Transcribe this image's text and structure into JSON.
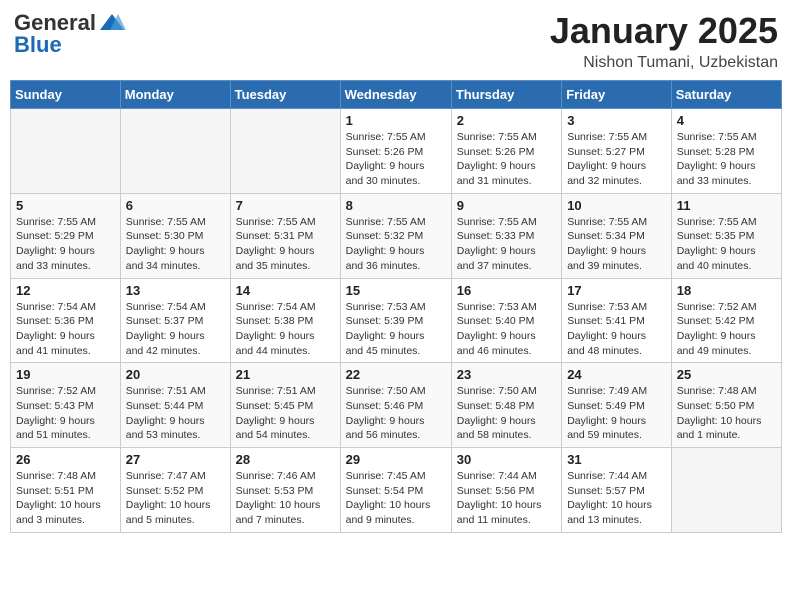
{
  "header": {
    "logo_general": "General",
    "logo_blue": "Blue",
    "month_title": "January 2025",
    "subtitle": "Nishon Tumani, Uzbekistan"
  },
  "weekdays": [
    "Sunday",
    "Monday",
    "Tuesday",
    "Wednesday",
    "Thursday",
    "Friday",
    "Saturday"
  ],
  "weeks": [
    [
      {
        "day": "",
        "info": ""
      },
      {
        "day": "",
        "info": ""
      },
      {
        "day": "",
        "info": ""
      },
      {
        "day": "1",
        "info": "Sunrise: 7:55 AM\nSunset: 5:26 PM\nDaylight: 9 hours\nand 30 minutes."
      },
      {
        "day": "2",
        "info": "Sunrise: 7:55 AM\nSunset: 5:26 PM\nDaylight: 9 hours\nand 31 minutes."
      },
      {
        "day": "3",
        "info": "Sunrise: 7:55 AM\nSunset: 5:27 PM\nDaylight: 9 hours\nand 32 minutes."
      },
      {
        "day": "4",
        "info": "Sunrise: 7:55 AM\nSunset: 5:28 PM\nDaylight: 9 hours\nand 33 minutes."
      }
    ],
    [
      {
        "day": "5",
        "info": "Sunrise: 7:55 AM\nSunset: 5:29 PM\nDaylight: 9 hours\nand 33 minutes."
      },
      {
        "day": "6",
        "info": "Sunrise: 7:55 AM\nSunset: 5:30 PM\nDaylight: 9 hours\nand 34 minutes."
      },
      {
        "day": "7",
        "info": "Sunrise: 7:55 AM\nSunset: 5:31 PM\nDaylight: 9 hours\nand 35 minutes."
      },
      {
        "day": "8",
        "info": "Sunrise: 7:55 AM\nSunset: 5:32 PM\nDaylight: 9 hours\nand 36 minutes."
      },
      {
        "day": "9",
        "info": "Sunrise: 7:55 AM\nSunset: 5:33 PM\nDaylight: 9 hours\nand 37 minutes."
      },
      {
        "day": "10",
        "info": "Sunrise: 7:55 AM\nSunset: 5:34 PM\nDaylight: 9 hours\nand 39 minutes."
      },
      {
        "day": "11",
        "info": "Sunrise: 7:55 AM\nSunset: 5:35 PM\nDaylight: 9 hours\nand 40 minutes."
      }
    ],
    [
      {
        "day": "12",
        "info": "Sunrise: 7:54 AM\nSunset: 5:36 PM\nDaylight: 9 hours\nand 41 minutes."
      },
      {
        "day": "13",
        "info": "Sunrise: 7:54 AM\nSunset: 5:37 PM\nDaylight: 9 hours\nand 42 minutes."
      },
      {
        "day": "14",
        "info": "Sunrise: 7:54 AM\nSunset: 5:38 PM\nDaylight: 9 hours\nand 44 minutes."
      },
      {
        "day": "15",
        "info": "Sunrise: 7:53 AM\nSunset: 5:39 PM\nDaylight: 9 hours\nand 45 minutes."
      },
      {
        "day": "16",
        "info": "Sunrise: 7:53 AM\nSunset: 5:40 PM\nDaylight: 9 hours\nand 46 minutes."
      },
      {
        "day": "17",
        "info": "Sunrise: 7:53 AM\nSunset: 5:41 PM\nDaylight: 9 hours\nand 48 minutes."
      },
      {
        "day": "18",
        "info": "Sunrise: 7:52 AM\nSunset: 5:42 PM\nDaylight: 9 hours\nand 49 minutes."
      }
    ],
    [
      {
        "day": "19",
        "info": "Sunrise: 7:52 AM\nSunset: 5:43 PM\nDaylight: 9 hours\nand 51 minutes."
      },
      {
        "day": "20",
        "info": "Sunrise: 7:51 AM\nSunset: 5:44 PM\nDaylight: 9 hours\nand 53 minutes."
      },
      {
        "day": "21",
        "info": "Sunrise: 7:51 AM\nSunset: 5:45 PM\nDaylight: 9 hours\nand 54 minutes."
      },
      {
        "day": "22",
        "info": "Sunrise: 7:50 AM\nSunset: 5:46 PM\nDaylight: 9 hours\nand 56 minutes."
      },
      {
        "day": "23",
        "info": "Sunrise: 7:50 AM\nSunset: 5:48 PM\nDaylight: 9 hours\nand 58 minutes."
      },
      {
        "day": "24",
        "info": "Sunrise: 7:49 AM\nSunset: 5:49 PM\nDaylight: 9 hours\nand 59 minutes."
      },
      {
        "day": "25",
        "info": "Sunrise: 7:48 AM\nSunset: 5:50 PM\nDaylight: 10 hours\nand 1 minute."
      }
    ],
    [
      {
        "day": "26",
        "info": "Sunrise: 7:48 AM\nSunset: 5:51 PM\nDaylight: 10 hours\nand 3 minutes."
      },
      {
        "day": "27",
        "info": "Sunrise: 7:47 AM\nSunset: 5:52 PM\nDaylight: 10 hours\nand 5 minutes."
      },
      {
        "day": "28",
        "info": "Sunrise: 7:46 AM\nSunset: 5:53 PM\nDaylight: 10 hours\nand 7 minutes."
      },
      {
        "day": "29",
        "info": "Sunrise: 7:45 AM\nSunset: 5:54 PM\nDaylight: 10 hours\nand 9 minutes."
      },
      {
        "day": "30",
        "info": "Sunrise: 7:44 AM\nSunset: 5:56 PM\nDaylight: 10 hours\nand 11 minutes."
      },
      {
        "day": "31",
        "info": "Sunrise: 7:44 AM\nSunset: 5:57 PM\nDaylight: 10 hours\nand 13 minutes."
      },
      {
        "day": "",
        "info": ""
      }
    ]
  ]
}
